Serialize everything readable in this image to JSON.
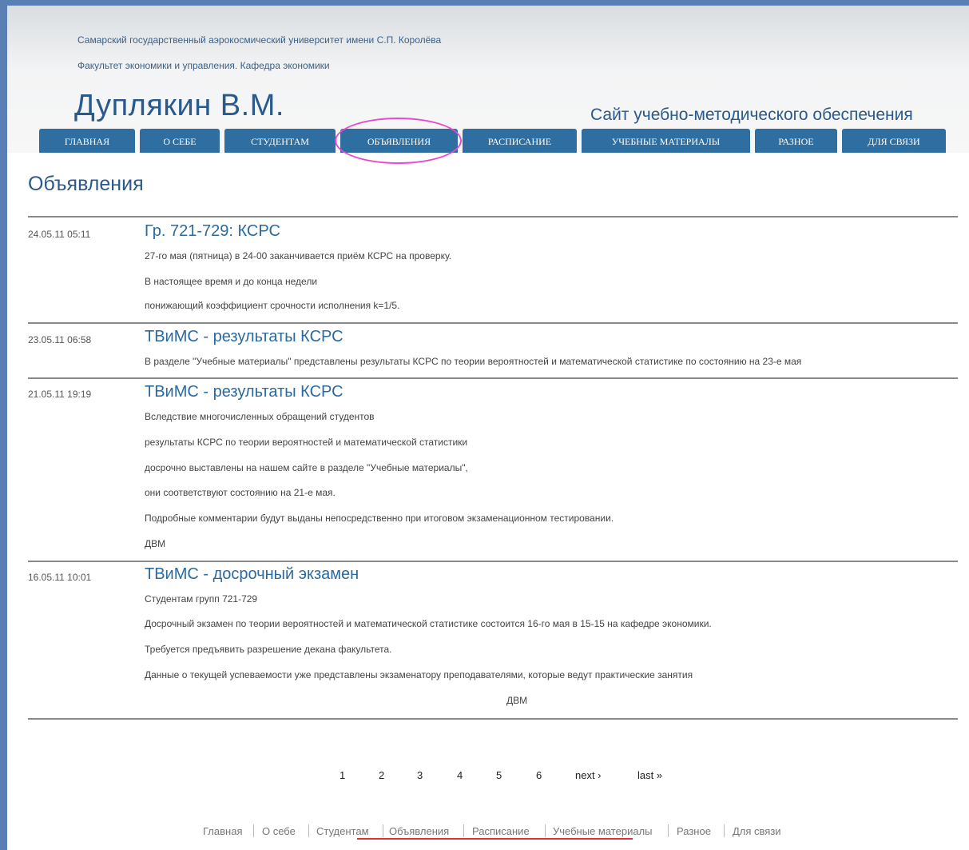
{
  "header": {
    "university": "Самарский государственный аэрокосмический университет имени С.П. Королёва",
    "faculty": "Факультет экономики и управления. Кафедра экономики",
    "site_name": "Дуплякин В.М.",
    "tagline": "Сайт учебно-методического обеспечения"
  },
  "nav": {
    "tabs": [
      "ГЛАВНАЯ",
      "О СЕБЕ",
      "СТУДЕНТАМ",
      "ОБЪЯВЛЕНИЯ",
      "РАСПИСАНИЕ",
      "УЧЕБНЫЕ МАТЕРИАЛЫ",
      "РАЗНОЕ",
      "ДЛЯ СВЯЗИ"
    ],
    "active": "ОБЪЯВЛЕНИЯ"
  },
  "page": {
    "title": "Объявления"
  },
  "posts": [
    {
      "date": "24.05.11 05:11",
      "title": "Гр. 721-729: КСРС",
      "lines": [
        "27-го мая (пятница)  в 24-00 заканчивается приём КСРС на проверку.",
        "В настоящее время и до конца недели",
        "понижающий коэффициент срочности исполнения k=1/5."
      ]
    },
    {
      "date": "23.05.11 06:58",
      "title": "ТВиМС - результаты КСРС",
      "lines": [
        "В разделе \"Учебные материалы\" представлены результаты КСРС по теории вероятностей и математической статистике по состоянию на 23-е мая"
      ]
    },
    {
      "date": "21.05.11 19:19",
      "title": "ТВиМС - результаты КСРС",
      "lines": [
        "Вследствие многочисленных обращений студентов",
        "результаты КСРС по теории вероятностей и математической статистики",
        "досрочно выставлены на нашем сайте в разделе \"Учебные материалы\",",
        "они соответствуют состоянию на 21-е мая.",
        "Подробные комментарии будут выданы непосредственно при итоговом экзаменационном тестировании.",
        "ДВМ"
      ]
    },
    {
      "date": "16.05.11 10:01",
      "title": "ТВиМС - досрочный экзамен",
      "lines": [
        "Студентам групп 721-729",
        "Досрочный экзамен по теории вероятностей и математической статистике состоится 16-го мая в 15-15 на кафедре экономики.",
        "Требуется предъявить разрешение декана факультета.",
        "Данные о текущей успеваемости уже представлены экзаменатору преподавателями, которые ведут практические занятия"
      ],
      "signature": "ДВМ"
    }
  ],
  "pager": {
    "pages": [
      "1",
      "2",
      "3",
      "4",
      "5",
      "6"
    ],
    "current": "1",
    "next": "next ›",
    "last": "last »"
  },
  "footer": {
    "links": [
      "Главная",
      "О себе",
      "Студентам",
      "Объявления",
      "Расписание",
      "Учебные материалы",
      "Разное",
      "Для связи"
    ]
  },
  "colors": {
    "frame": "#5a7fb5",
    "nav_tab": "#2e6ea1",
    "heading": "#2a5a8c",
    "highlight_ring": "#e64bcf",
    "footer_underline": "#e0303a"
  }
}
